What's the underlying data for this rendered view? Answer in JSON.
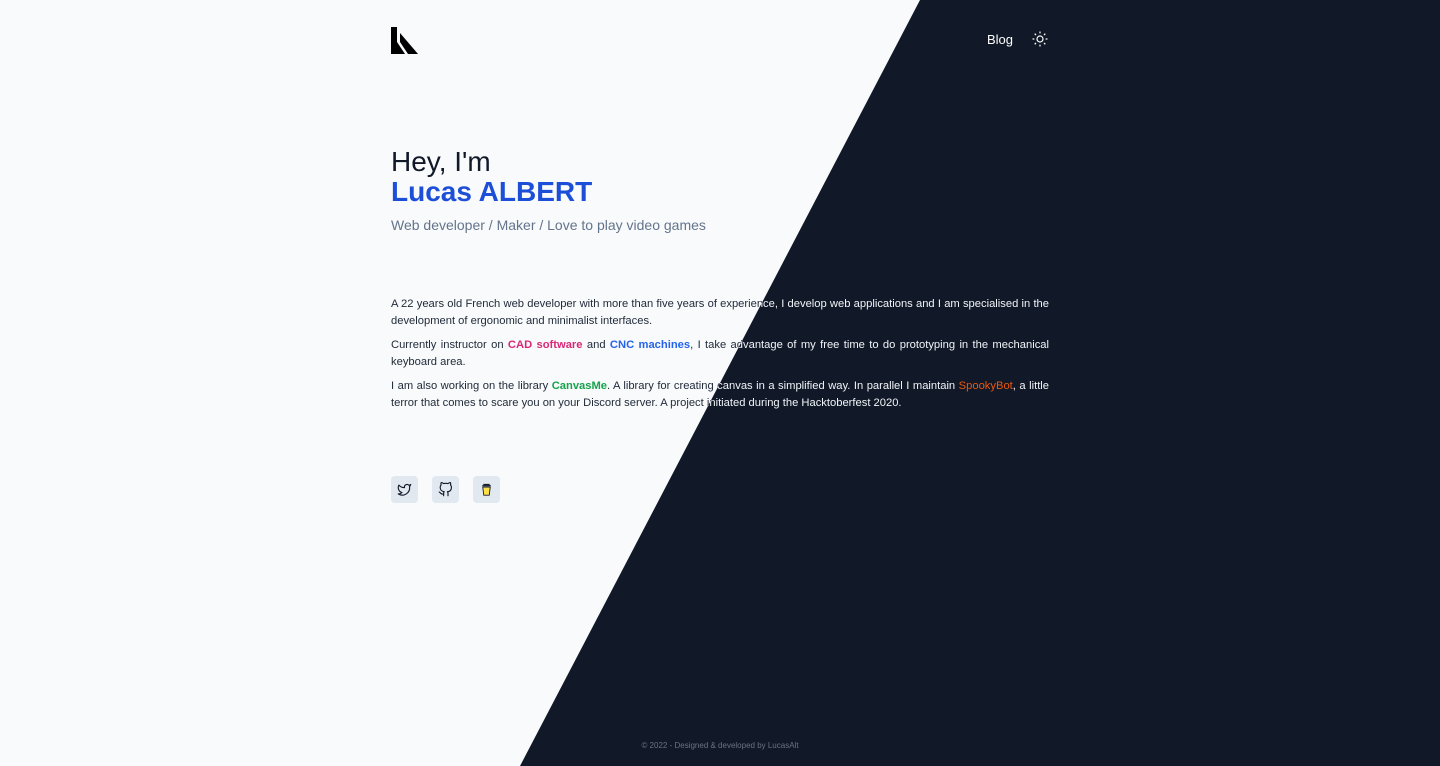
{
  "nav": {
    "blog_label": "Blog",
    "logo_icon": "logo-icon",
    "theme_icon": "sun-icon"
  },
  "hero": {
    "greeting": "Hey, I'm",
    "name": "Lucas ALBERT",
    "tagline": "Web developer / Maker / Love to play video games"
  },
  "bio": {
    "p1": "A 22 years old French web developer with more than five years of experience, I develop web applications and I am specialised in the development of ergonomic and minimalist interfaces.",
    "p2_before": "Currently instructor on ",
    "p2_link1": "CAD software",
    "p2_mid": " and ",
    "p2_link2": "CNC machines",
    "p2_after": ", I take advantage of my free time to do prototyping in the mechanical keyboard area.",
    "p3_before": "I am also working on the library ",
    "p3_link1": "CanvasMe",
    "p3_mid": ". A library for creating canvas in a simplified way. In parallel I maintain ",
    "p3_link2": "SpookyBot",
    "p3_after": ", a little terror that comes to scare you on your Discord server. A project initiated during the Hacktoberfest 2020."
  },
  "socials": [
    {
      "icon": "twitter-icon"
    },
    {
      "icon": "github-icon"
    },
    {
      "icon": "coffee-cup-icon"
    }
  ],
  "footer": {
    "text": "© 2022 - Designed & developed by LucasAlt"
  },
  "colors": {
    "background_light": "#f8fafc",
    "background_dark": "#111827",
    "name_accent": "#1d4ed8",
    "cad_link": "#db2777",
    "cnc_link": "#2563eb",
    "canvasme_link": "#16a34a",
    "spookybot_link": "#ea580c"
  }
}
